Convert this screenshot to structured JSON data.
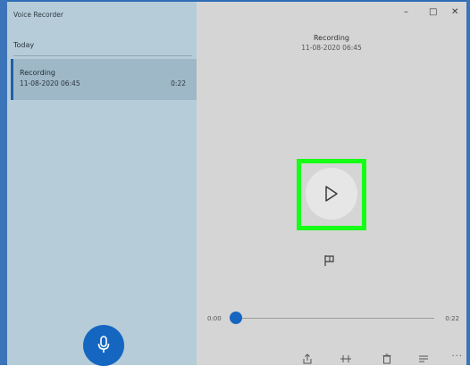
{
  "app": {
    "title": "Voice Recorder"
  },
  "window_controls": {
    "minimize": "–",
    "maximize": "□",
    "close": "✕"
  },
  "sidebar": {
    "group_header": "Today",
    "recordings": [
      {
        "name": "Recording",
        "date": "11-08-2020 06:45",
        "duration": "0:22"
      }
    ]
  },
  "player": {
    "title": "Recording",
    "date": "11-08-2020 06:45",
    "time_elapsed": "0:00",
    "time_total": "0:22",
    "progress": 0.0
  },
  "icons": {
    "mic": "microphone-icon",
    "play": "play-icon",
    "flag": "flag-icon",
    "share": "share-icon",
    "trim": "trim-icon",
    "delete": "delete-icon",
    "rename": "rename-icon",
    "more": "more-icon"
  },
  "more_label": "···",
  "colors": {
    "accent": "#1566c0",
    "highlight": "#16ff16",
    "sidebar_bg": "#b6ccd8",
    "selected_bg": "#9fb8c7",
    "main_bg": "#d5d5d5"
  }
}
